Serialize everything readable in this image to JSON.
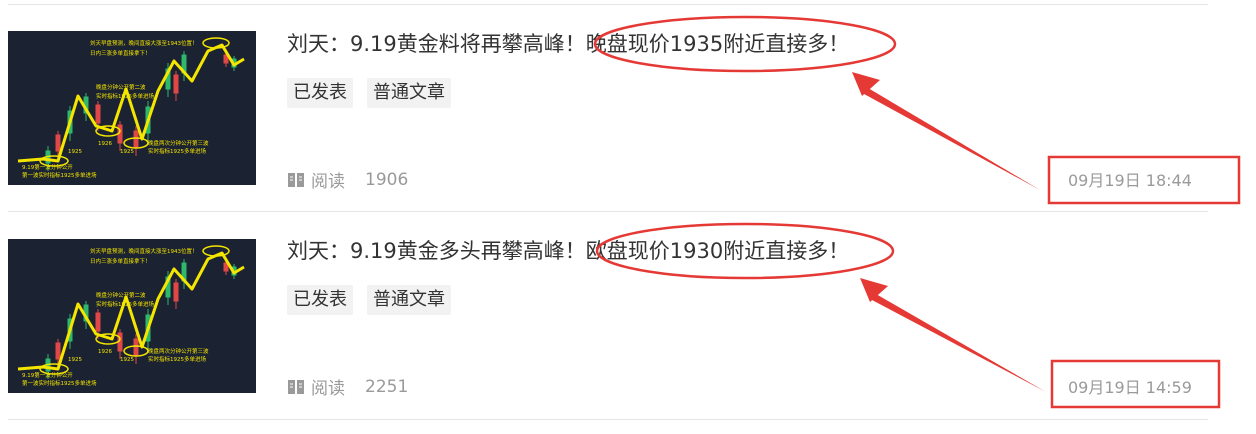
{
  "articles": [
    {
      "title": "刘天：9.19黄金料将再攀高峰！晚盘现价1935附近直接多！",
      "tags": [
        "已发表",
        "普通文章"
      ],
      "read_label": "阅读",
      "read_count": "1906",
      "date": "09月19日 18:44",
      "thumbnail_text": {
        "callout_top": "刘天早盘预测，晚间直接大涨至1943位置！",
        "callout_top2": "日内三涨多单直接拿下！",
        "callout_mid": "晚盘分钟公开第二波",
        "callout_mid2": "实时指标1925多单进场",
        "callout_bottom": "晚盘两次分钟公开第三波",
        "callout_bottom2": "实时指标1925多单进场",
        "callout_left": "9.19第一波分钟公开",
        "callout_left2": "第一波实时指标1925多单进场",
        "level_a": "1926",
        "level_b": "1925",
        "level_c": "1925"
      }
    },
    {
      "title": "刘天：9.19黄金多头再攀高峰！欧盘现价1930附近直接多！",
      "tags": [
        "已发表",
        "普通文章"
      ],
      "read_label": "阅读",
      "read_count": "2251",
      "date": "09月19日 14:59",
      "thumbnail_text": {
        "callout_top": "刘天早盘预测，晚间直接大涨至1943位置！",
        "callout_top2": "日内三涨多单直接拿下！",
        "callout_mid": "晚盘分钟公开第二波",
        "callout_mid2": "实时指标1925多单进场",
        "callout_bottom": "晚盘两次分钟公开第三波",
        "callout_bottom2": "实时指标1925多单进场",
        "callout_left": "9.19第一波分钟公开",
        "callout_left2": "第一波实时指标1925多单进场",
        "level_a": "1926",
        "level_b": "1925",
        "level_c": "1925"
      }
    }
  ],
  "colors": {
    "annotation_red": "#e53935",
    "thumb_bg": "#1b2231",
    "thumb_yellow": "#f5e600",
    "candle_up": "#2fb86b",
    "candle_down": "#e04848"
  }
}
